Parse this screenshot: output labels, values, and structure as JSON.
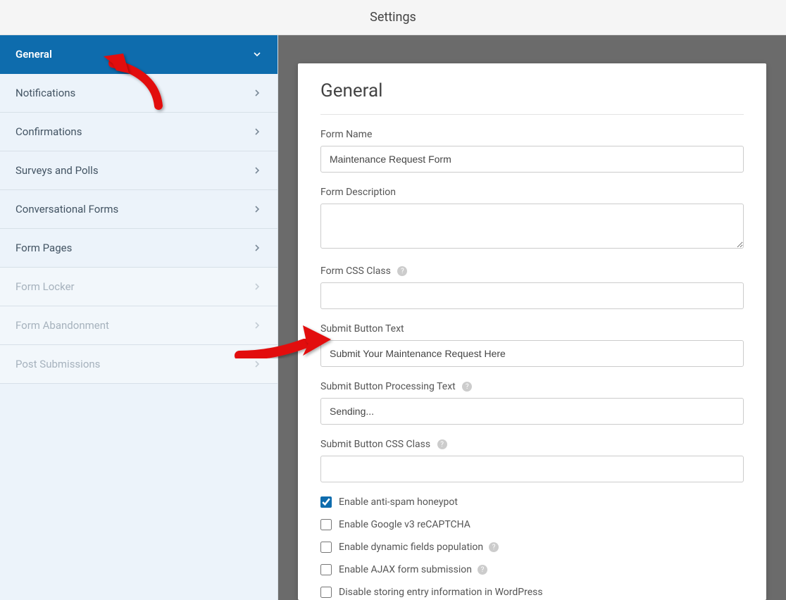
{
  "header": {
    "title": "Settings"
  },
  "sidebar": {
    "items": [
      {
        "label": "General",
        "active": true
      },
      {
        "label": "Notifications"
      },
      {
        "label": "Confirmations"
      },
      {
        "label": "Surveys and Polls"
      },
      {
        "label": "Conversational Forms"
      },
      {
        "label": "Form Pages"
      },
      {
        "label": "Form Locker",
        "disabled": true
      },
      {
        "label": "Form Abandonment",
        "disabled": true
      },
      {
        "label": "Post Submissions",
        "disabled": true
      }
    ]
  },
  "panel": {
    "title": "General",
    "form_name_label": "Form Name",
    "form_name_value": "Maintenance Request Form",
    "form_desc_label": "Form Description",
    "form_desc_value": "",
    "form_css_label": "Form CSS Class",
    "form_css_value": "",
    "submit_text_label": "Submit Button Text",
    "submit_text_value": "Submit Your Maintenance Request Here",
    "submit_proc_label": "Submit Button Processing Text",
    "submit_proc_value": "Sending...",
    "submit_css_label": "Submit Button CSS Class",
    "submit_css_value": "",
    "checkboxes": [
      {
        "label": "Enable anti-spam honeypot",
        "checked": true,
        "help": false
      },
      {
        "label": "Enable Google v3 reCAPTCHA",
        "checked": false,
        "help": false
      },
      {
        "label": "Enable dynamic fields population",
        "checked": false,
        "help": true
      },
      {
        "label": "Enable AJAX form submission",
        "checked": false,
        "help": true
      },
      {
        "label": "Disable storing entry information in WordPress",
        "checked": false,
        "help": false
      }
    ]
  }
}
